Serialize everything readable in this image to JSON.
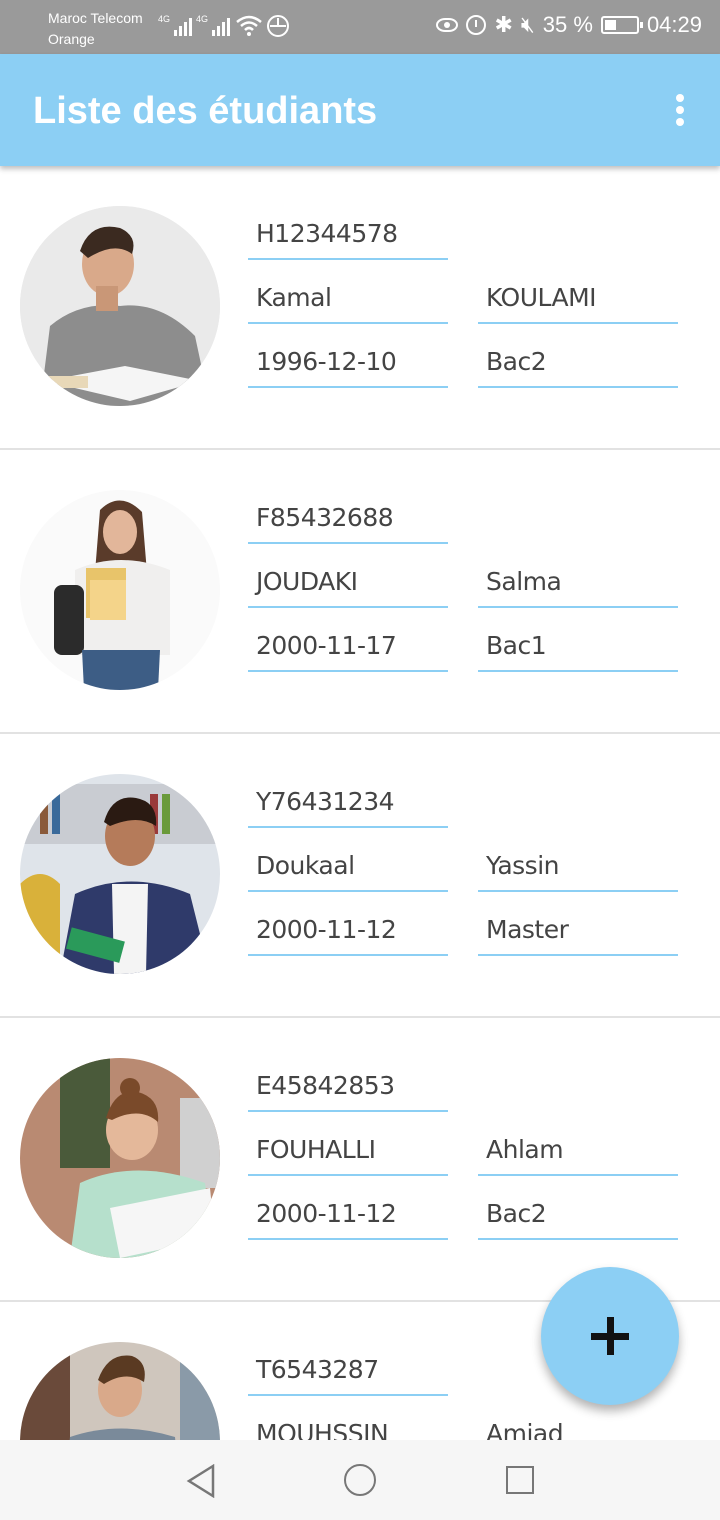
{
  "status_bar": {
    "carrier_1": "Maroc Telecom",
    "carrier_2": "Orange",
    "network_1": "4G",
    "network_2": "4G",
    "battery": "35 %",
    "time": "04:29"
  },
  "app_bar": {
    "title": "Liste des étudiants",
    "menu_icon": "more-vert-icon"
  },
  "students": [
    {
      "id": "H12344578",
      "first": "Kamal",
      "second": "KOULAMI",
      "date": "1996-12-10",
      "level": "Bac2"
    },
    {
      "id": "F85432688",
      "first": "JOUDAKI",
      "second": "Salma",
      "date": "2000-11-17",
      "level": "Bac1"
    },
    {
      "id": "Y76431234",
      "first": "Doukaal",
      "second": "Yassin",
      "date": "2000-11-12",
      "level": "Master"
    },
    {
      "id": "E45842853",
      "first": "FOUHALLI",
      "second": "Ahlam",
      "date": "2000-11-12",
      "level": "Bac2"
    },
    {
      "id": "T6543287",
      "first": "MOUHSSIN",
      "second": "Amjad",
      "date": "",
      "level": ""
    }
  ],
  "fab": {
    "icon": "plus-icon"
  },
  "colors": {
    "accent": "#8ccff4",
    "status_bar": "#9a9a9a",
    "text": "#444444"
  }
}
